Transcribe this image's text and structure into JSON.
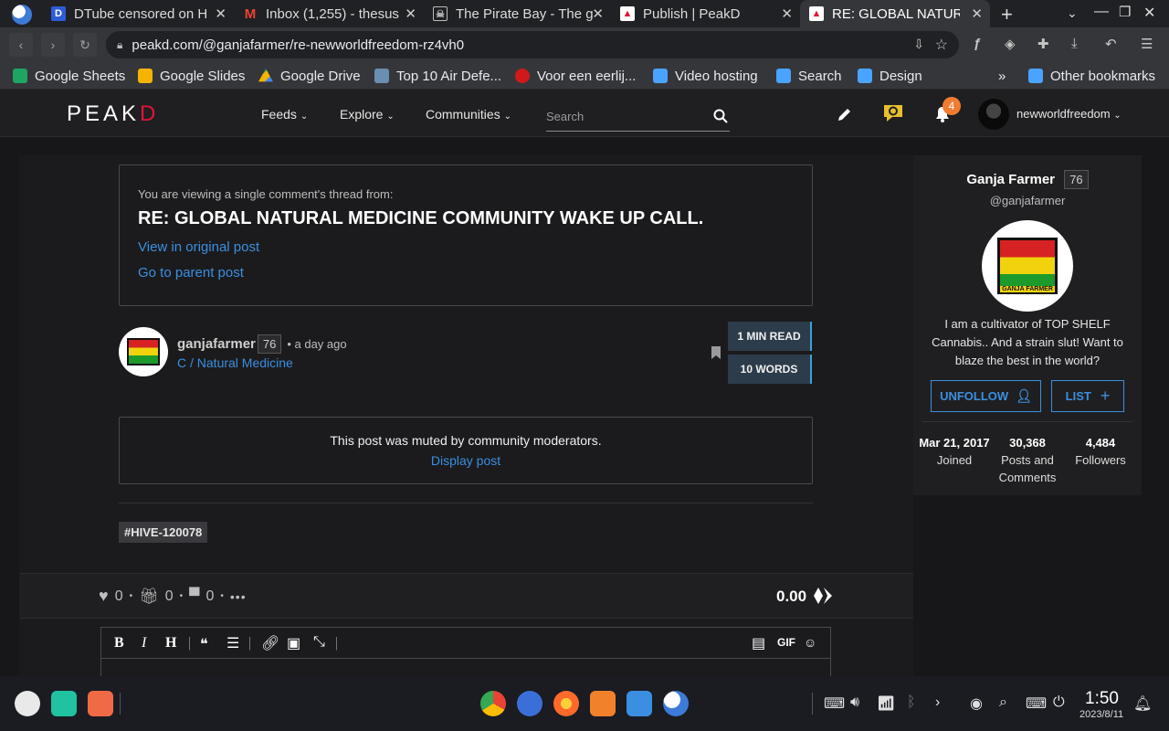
{
  "tabs": [
    {
      "title": "DTube censored on H",
      "icon_color": "#2e5bd8"
    },
    {
      "title": "Inbox (1,255) - thesus",
      "icon_color": "#ea4335"
    },
    {
      "title": "The Pirate Bay - The g",
      "icon_color": "#bbbbbb"
    },
    {
      "title": "Publish | PeakD",
      "icon_color": "#e31337"
    },
    {
      "title": "RE: GLOBAL NATURAL",
      "icon_color": "#e31337"
    }
  ],
  "address": "peakd.com/@ganjafarmer/re-newworldfreedom-rz4vh0",
  "bookmarks": [
    {
      "label": "Google Sheets",
      "color": "#1fa463"
    },
    {
      "label": "Google Slides",
      "color": "#f4b400"
    },
    {
      "label": "Google Drive",
      "color": "#4285f4"
    },
    {
      "label": "Top 10 Air Defe...",
      "color": "#6a8fb0"
    },
    {
      "label": "Voor een eerlij...",
      "color": "#d01a1a"
    },
    {
      "label": "Video hosting",
      "color": "#4aa3ff"
    },
    {
      "label": "Search",
      "color": "#4aa3ff"
    },
    {
      "label": "Design",
      "color": "#4aa3ff"
    }
  ],
  "more_bookmarks": "»",
  "other_bookmarks": "Other bookmarks",
  "site": {
    "logo_a": "PEAK",
    "logo_b": "D",
    "nav": [
      "Feeds",
      "Explore",
      "Communities"
    ],
    "search_placeholder": "Search",
    "notif_count": "4",
    "username": "newworldfreedom"
  },
  "thread": {
    "intro": "You are viewing a single comment's thread from:",
    "title": "RE: GLOBAL NATURAL MEDICINE COMMUNITY WAKE UP CALL.",
    "view_original": "View in original post",
    "go_parent": "Go to parent post"
  },
  "post": {
    "author": "ganjafarmer",
    "reputation": "76",
    "time": "• a day ago",
    "community": "C / Natural Medicine",
    "read_time": "1 MIN READ",
    "words": "10 WORDS",
    "muted_text": "This post was muted by community moderators.",
    "display_post": "Display post",
    "tag": "#HIVE-120078",
    "likes": "0",
    "gifts": "0",
    "comments": "0",
    "payout": "0.00"
  },
  "editor": {
    "bold": "B",
    "italic": "I",
    "heading": "H",
    "gif": "GIF"
  },
  "profile": {
    "name": "Ganja Farmer",
    "reputation": "76",
    "handle": "@ganjafarmer",
    "logo_text": "GANJA FARMER",
    "bio": "I am a cultivator of TOP SHELF Cannabis.. And a strain slut! Want to blaze the best in the world?",
    "unfollow": "UNFOLLOW",
    "list": "LIST",
    "joined_value": "Mar 21, 2017",
    "joined_label": "Joined",
    "posts_value": "30,368",
    "posts_label": "Posts and Comments",
    "followers_value": "4,484",
    "followers_label": "Followers"
  },
  "clock": {
    "time": "1:50",
    "date": "2023/8/11"
  }
}
